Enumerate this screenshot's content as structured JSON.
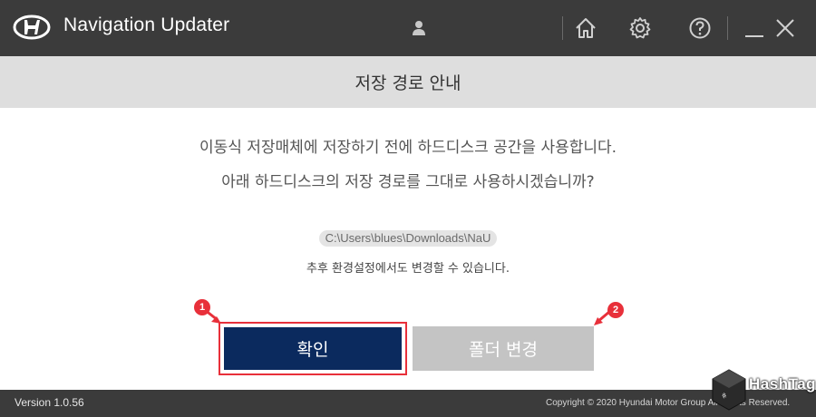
{
  "window": {
    "title": "Navigation Updater",
    "controls": {
      "minimize_glyph": "_"
    },
    "icons": [
      "hyundai-logo-icon",
      "user-icon",
      "home-icon",
      "gear-icon",
      "help-icon",
      "minimize-icon",
      "close-icon"
    ],
    "background_color": "#3b3b3b"
  },
  "dialog": {
    "heading": "저장 경로 안내",
    "message_line1": "이동식 저장매체에 저장하기 전에 하드디스크 공간을 사용합니다.",
    "message_line2": "아래 하드디스크의 저장 경로를 그대로 사용하시겠습니까?",
    "path": "C:\\Users\\blues\\Downloads\\NaU",
    "note": "추후 환경설정에서도 변경할 수 있습니다."
  },
  "buttons": {
    "confirm_label": "확인",
    "change_folder_label": "폴더 변경",
    "confirm_color": "#0b2a5e",
    "change_folder_color": "#c4c4c4"
  },
  "annotations": {
    "badge1": "1",
    "badge2": "2",
    "highlight_color": "#e8303a"
  },
  "footer": {
    "version": "Version 1.0.56",
    "copyright": "Copyright © 2020 Hyundai Motor Group All Rights Reserved."
  },
  "watermark": {
    "text": "HashTag"
  }
}
